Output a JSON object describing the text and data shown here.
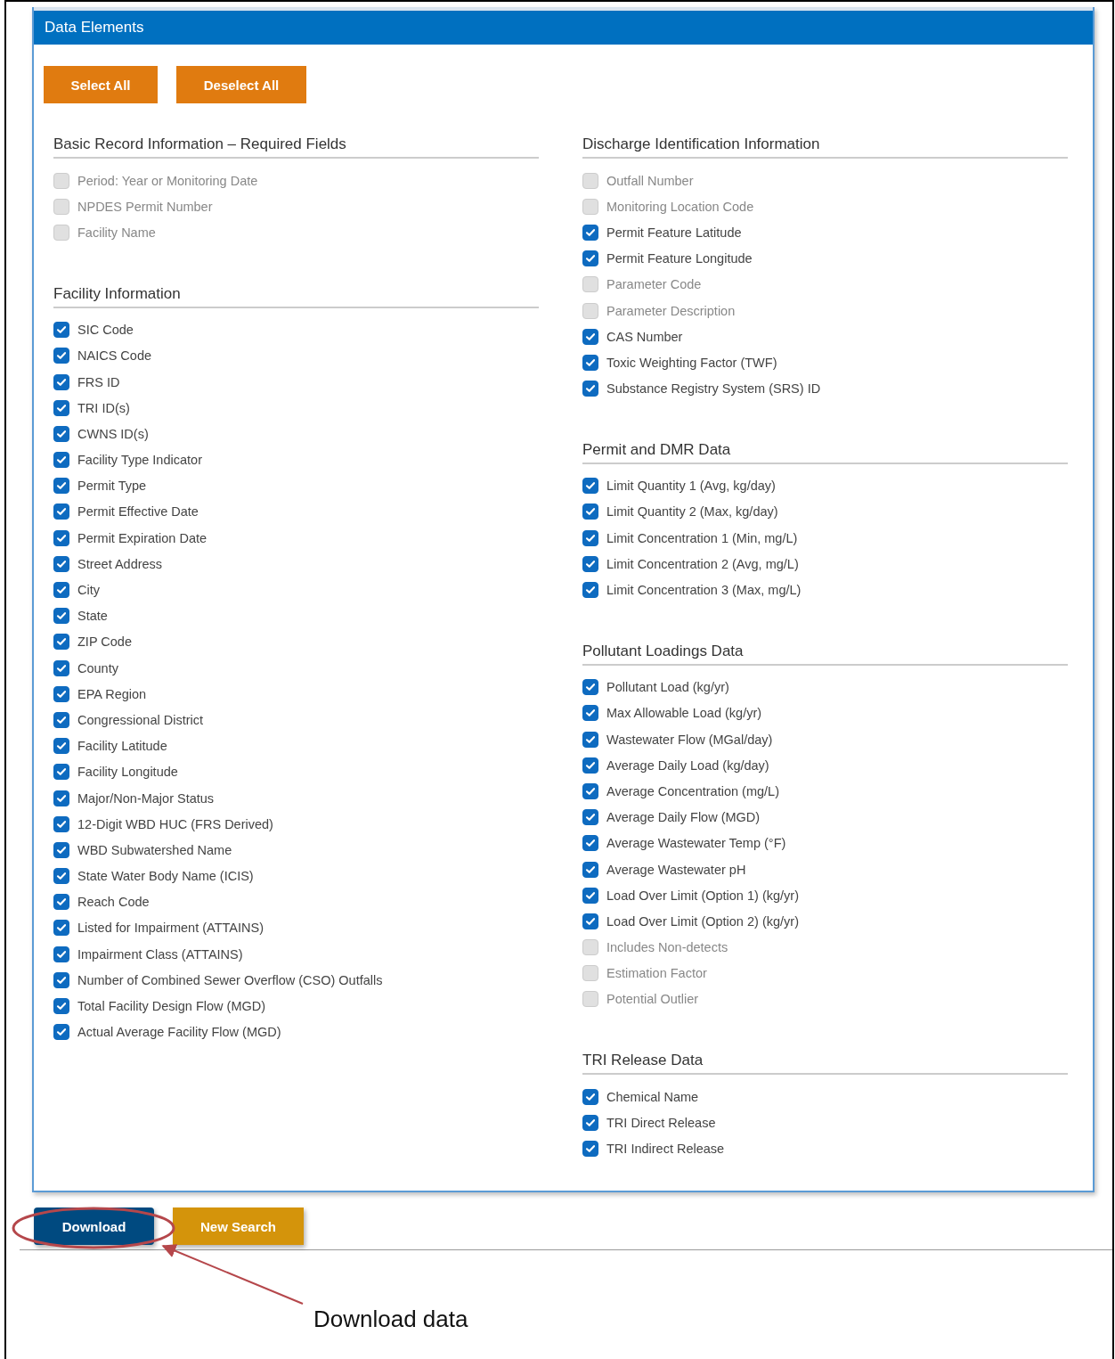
{
  "panel": {
    "title": "Data Elements"
  },
  "top_buttons": [
    "Select All",
    "Deselect All"
  ],
  "columns": [
    {
      "sections": [
        {
          "title": "Basic Record Information – Required Fields",
          "items": [
            {
              "label": "Period: Year or Monitoring Date",
              "checked": false
            },
            {
              "label": "NPDES Permit Number",
              "checked": false
            },
            {
              "label": "Facility Name",
              "checked": false
            }
          ]
        },
        {
          "title": "Facility Information",
          "items": [
            {
              "label": "SIC Code",
              "checked": true
            },
            {
              "label": "NAICS Code",
              "checked": true
            },
            {
              "label": "FRS ID",
              "checked": true
            },
            {
              "label": "TRI ID(s)",
              "checked": true
            },
            {
              "label": "CWNS ID(s)",
              "checked": true
            },
            {
              "label": "Facility Type Indicator",
              "checked": true
            },
            {
              "label": "Permit Type",
              "checked": true
            },
            {
              "label": "Permit Effective Date",
              "checked": true
            },
            {
              "label": "Permit Expiration Date",
              "checked": true
            },
            {
              "label": "Street Address",
              "checked": true
            },
            {
              "label": "City",
              "checked": true
            },
            {
              "label": "State",
              "checked": true
            },
            {
              "label": "ZIP Code",
              "checked": true
            },
            {
              "label": "County",
              "checked": true
            },
            {
              "label": "EPA Region",
              "checked": true
            },
            {
              "label": "Congressional District",
              "checked": true
            },
            {
              "label": "Facility Latitude",
              "checked": true
            },
            {
              "label": "Facility Longitude",
              "checked": true
            },
            {
              "label": "Major/Non-Major Status",
              "checked": true
            },
            {
              "label": "12-Digit WBD HUC (FRS Derived)",
              "checked": true
            },
            {
              "label": "WBD Subwatershed Name",
              "checked": true
            },
            {
              "label": "State Water Body Name (ICIS)",
              "checked": true
            },
            {
              "label": "Reach Code",
              "checked": true
            },
            {
              "label": "Listed for Impairment (ATTAINS)",
              "checked": true
            },
            {
              "label": "Impairment Class (ATTAINS)",
              "checked": true
            },
            {
              "label": "Number of Combined Sewer Overflow (CSO) Outfalls",
              "checked": true
            },
            {
              "label": "Total Facility Design Flow (MGD)",
              "checked": true
            },
            {
              "label": "Actual Average Facility Flow (MGD)",
              "checked": true
            }
          ]
        }
      ]
    },
    {
      "sections": [
        {
          "title": "Discharge Identification Information",
          "items": [
            {
              "label": "Outfall Number",
              "checked": false
            },
            {
              "label": "Monitoring Location Code",
              "checked": false
            },
            {
              "label": "Permit Feature Latitude",
              "checked": true
            },
            {
              "label": "Permit Feature Longitude",
              "checked": true
            },
            {
              "label": "Parameter Code",
              "checked": false
            },
            {
              "label": "Parameter Description",
              "checked": false
            },
            {
              "label": "CAS Number",
              "checked": true
            },
            {
              "label": "Toxic Weighting Factor (TWF)",
              "checked": true
            },
            {
              "label": "Substance Registry System (SRS) ID",
              "checked": true
            }
          ]
        },
        {
          "title": "Permit and DMR Data",
          "items": [
            {
              "label": "Limit Quantity 1 (Avg, kg/day)",
              "checked": true
            },
            {
              "label": "Limit Quantity 2 (Max, kg/day)",
              "checked": true
            },
            {
              "label": "Limit Concentration 1 (Min, mg/L)",
              "checked": true
            },
            {
              "label": "Limit Concentration 2 (Avg, mg/L)",
              "checked": true
            },
            {
              "label": "Limit Concentration 3 (Max, mg/L)",
              "checked": true
            }
          ]
        },
        {
          "title": "Pollutant Loadings Data",
          "items": [
            {
              "label": "Pollutant Load (kg/yr)",
              "checked": true
            },
            {
              "label": "Max Allowable Load (kg/yr)",
              "checked": true
            },
            {
              "label": "Wastewater Flow (MGal/day)",
              "checked": true
            },
            {
              "label": "Average Daily Load (kg/day)",
              "checked": true
            },
            {
              "label": "Average Concentration (mg/L)",
              "checked": true
            },
            {
              "label": "Average Daily Flow (MGD)",
              "checked": true
            },
            {
              "label": "Average Wastewater Temp (°F)",
              "checked": true
            },
            {
              "label": "Average Wastewater pH",
              "checked": true
            },
            {
              "label": "Load Over Limit (Option 1) (kg/yr)",
              "checked": true
            },
            {
              "label": "Load Over Limit (Option 2) (kg/yr)",
              "checked": true
            },
            {
              "label": "Includes Non-detects",
              "checked": false
            },
            {
              "label": "Estimation Factor",
              "checked": false
            },
            {
              "label": "Potential Outlier",
              "checked": false
            }
          ]
        },
        {
          "title": "TRI Release Data",
          "items": [
            {
              "label": "Chemical Name",
              "checked": true
            },
            {
              "label": "TRI Direct Release",
              "checked": true
            },
            {
              "label": "TRI Indirect Release",
              "checked": true
            }
          ]
        }
      ]
    }
  ],
  "bottom_buttons": [
    {
      "label": "Download",
      "kind": "primary"
    },
    {
      "label": "New Search",
      "kind": "secondary"
    }
  ],
  "annotation": {
    "text": "Download data"
  }
}
